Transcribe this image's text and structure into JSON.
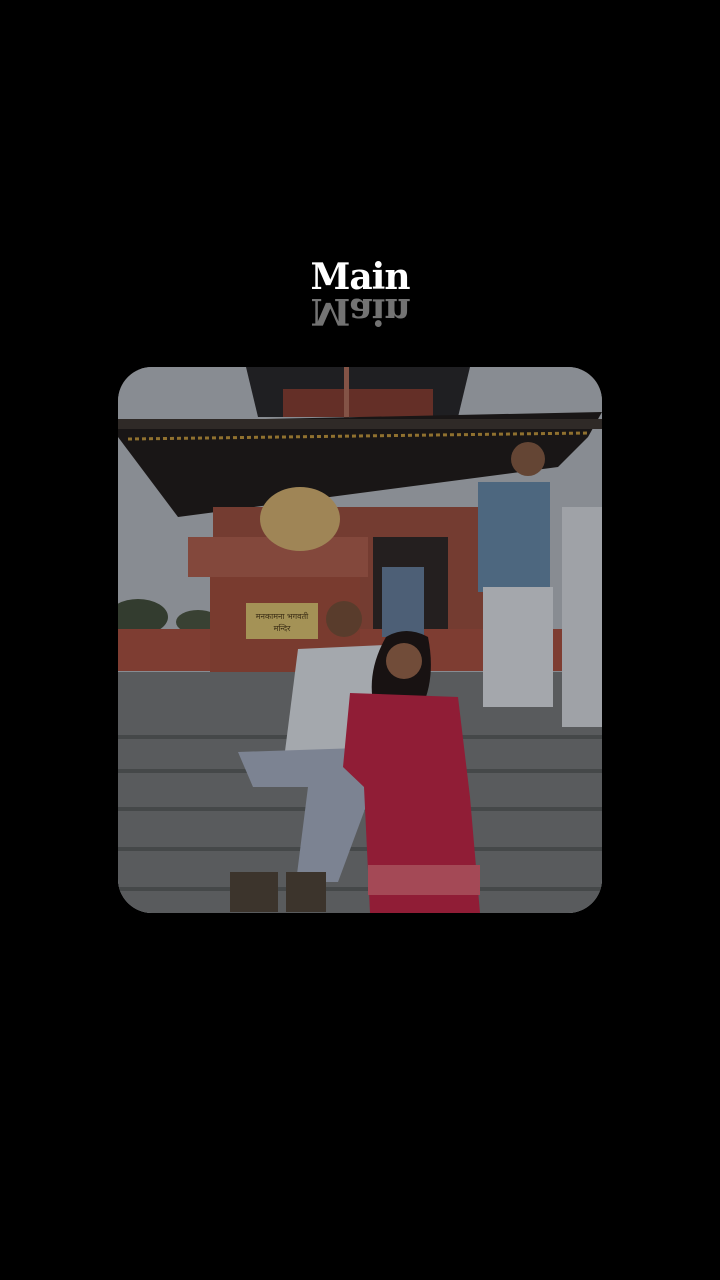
{
  "title": {
    "text": "Main",
    "reflection_text": "Main",
    "color": "#ffffff"
  },
  "photo": {
    "description_icon": "photo-image",
    "plaque_text": "मनकामना भगवती मन्दिर"
  },
  "colors": {
    "background": "#000000",
    "sky": "#a9adb3",
    "roof": "#2a2520",
    "brick": "#9a4a3a",
    "stairs": "#66696c",
    "dress": "#b0213f",
    "shirt": "#c8ccd3"
  }
}
